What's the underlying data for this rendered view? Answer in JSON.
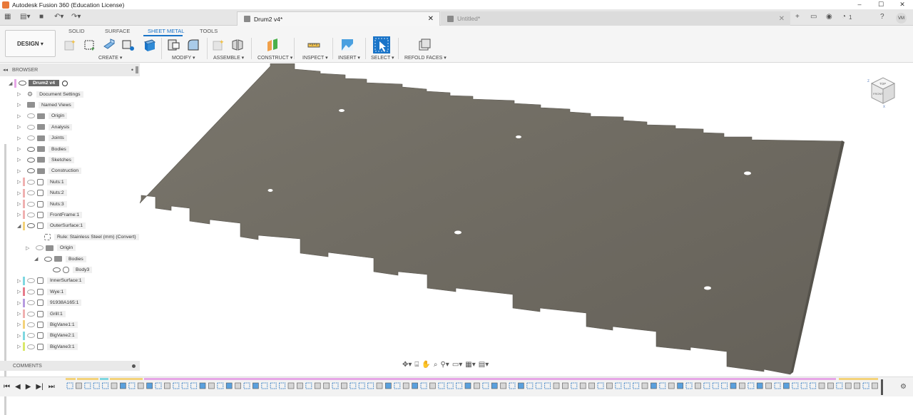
{
  "window": {
    "title": "Autodesk Fusion 360 (Education License)",
    "minimize": "–",
    "maximize": "☐",
    "close": "✕"
  },
  "tabs": {
    "active_label": "Drum2 v4*",
    "inactive_label": "Untitled*",
    "close": "✕",
    "notifications": "1",
    "avatar": "VM"
  },
  "toolbar": {
    "workspace": "DESIGN ▾",
    "tabs": [
      "SOLID",
      "SURFACE",
      "SHEET METAL",
      "TOOLS"
    ],
    "groups": [
      "CREATE ▾",
      "MODIFY ▾",
      "ASSEMBLE ▾",
      "CONSTRUCT ▾",
      "INSPECT ▾",
      "INSERT ▾",
      "SELECT ▾",
      "REFOLD FACES ▾"
    ]
  },
  "browser": {
    "title": "BROWSER",
    "root": "Drum2 v4",
    "items": [
      {
        "label": "Document Settings",
        "kind": "gear",
        "color": ""
      },
      {
        "label": "Named Views",
        "kind": "folder",
        "color": ""
      },
      {
        "label": "Origin",
        "kind": "folder",
        "color": ""
      },
      {
        "label": "Analysis",
        "kind": "folder",
        "color": ""
      },
      {
        "label": "Joints",
        "kind": "folder",
        "color": ""
      },
      {
        "label": "Bodies",
        "kind": "folder",
        "color": ""
      },
      {
        "label": "Sketches",
        "kind": "folder",
        "color": ""
      },
      {
        "label": "Construction",
        "kind": "folder",
        "color": ""
      },
      {
        "label": "Nuts:1",
        "kind": "comp",
        "color": "#f0b0b0"
      },
      {
        "label": "Nuts:2",
        "kind": "comp",
        "color": "#f0b0b0"
      },
      {
        "label": "Nuts:3",
        "kind": "comp",
        "color": "#f0b0b0"
      },
      {
        "label": "FrontFrame:1",
        "kind": "comp",
        "color": "#f0b0b0"
      },
      {
        "label": "OuterSurface:1",
        "kind": "comp",
        "color": "#f3d27a"
      },
      {
        "label": "Rule: Stainless Steel (mm) (Convert)",
        "kind": "rule",
        "color": ""
      },
      {
        "label": "Origin",
        "kind": "folder",
        "color": ""
      },
      {
        "label": "Bodies",
        "kind": "folder",
        "color": ""
      },
      {
        "label": "Body3",
        "kind": "body",
        "color": ""
      },
      {
        "label": "InnerSurface:1",
        "kind": "comp",
        "color": "#7fd7e0"
      },
      {
        "label": "Wye:1",
        "kind": "comp",
        "color": "#e77a8a"
      },
      {
        "label": "91938A165:1",
        "kind": "comp",
        "color": "#b79be0"
      },
      {
        "label": "Grill:1",
        "kind": "comp",
        "color": "#f0b0b0"
      },
      {
        "label": "BigVane1:1",
        "kind": "comp",
        "color": "#f3d27a"
      },
      {
        "label": "BigVane2:1",
        "kind": "comp",
        "color": "#7fd7e0"
      },
      {
        "label": "BigVane3:1",
        "kind": "comp",
        "color": "#d9e86a"
      }
    ]
  },
  "comments": {
    "title": "COMMENTS"
  },
  "viewcube": {
    "top": "TOP",
    "front": "FRONT"
  },
  "timeline": {
    "controls": [
      "⏮",
      "◀",
      "▶",
      "▶|",
      "⏭"
    ]
  },
  "colors": {
    "accent": "#1a74c8",
    "sheet_metal_top": "#6f6b61",
    "sheet_metal_edge": "#55524b",
    "timeline_pink": "#e6a6e6",
    "timeline_yellow": "#f3d27a",
    "timeline_blue": "#7fd7e0"
  }
}
